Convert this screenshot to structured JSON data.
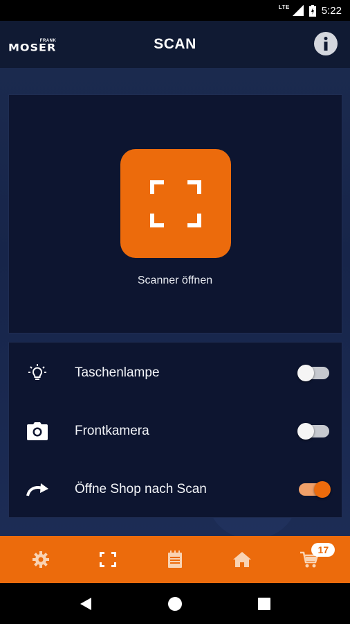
{
  "status_bar": {
    "network": "LTE",
    "time": "5:22"
  },
  "header": {
    "logo_small": "FRANK",
    "logo_main": "MOSER",
    "title": "SCAN"
  },
  "scan": {
    "button_label": "Scanner öffnen"
  },
  "settings": {
    "items": [
      {
        "label": "Taschenlampe",
        "icon": "lightbulb-icon",
        "enabled": false
      },
      {
        "label": "Frontkamera",
        "icon": "camera-icon",
        "enabled": false
      },
      {
        "label": "Öffne Shop nach Scan",
        "icon": "redo-arrow-icon",
        "enabled": true
      }
    ]
  },
  "bottom_nav": {
    "items": [
      "gear-icon",
      "scan-icon",
      "notepad-icon",
      "home-icon",
      "cart-icon"
    ],
    "cart_count": "17"
  },
  "colors": {
    "accent": "#ec6b0c",
    "panel": "#0d1530",
    "background": "#1b2a4e"
  }
}
